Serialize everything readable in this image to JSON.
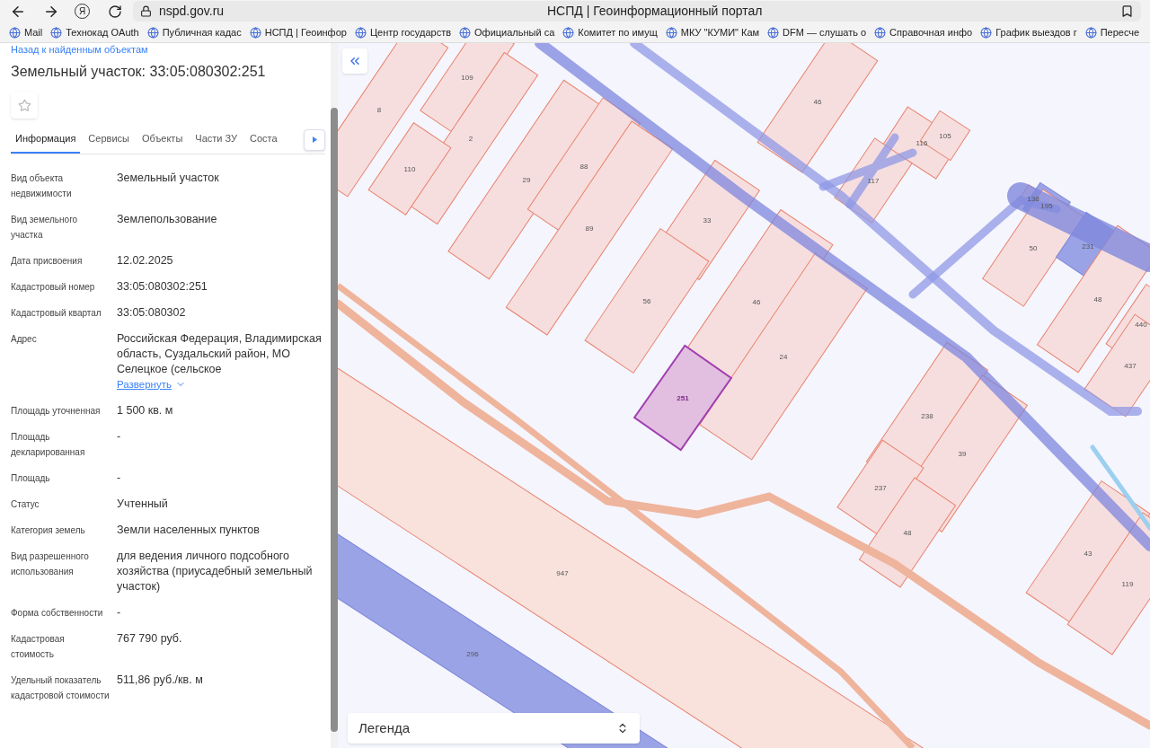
{
  "browser": {
    "home_glyph": "Я",
    "url": "nspd.gov.ru",
    "title": "НСПД | Геоинформационный портал",
    "bookmarks": [
      "Mail",
      "Технокад OAuth",
      "Публичная кадас",
      "НСПД | Геоинфор",
      "Центр государств",
      "Официальный са",
      "Комитет по имущ",
      "МКУ \"КУМИ\" Кам",
      "DFM — слушать о",
      "Справочная инфо",
      "График выездов г",
      "Пересче"
    ]
  },
  "panel": {
    "back_link": "Назад к найденным объектам",
    "title": "Земельный участок: 33:05:080302:251",
    "favorite": {
      "starred": false
    },
    "tabs": [
      {
        "label": "Информация",
        "selected": true
      },
      {
        "label": "Сервисы",
        "selected": false
      },
      {
        "label": "Объекты",
        "selected": false
      },
      {
        "label": "Части ЗУ",
        "selected": false
      },
      {
        "label": "Соста",
        "selected": false
      }
    ],
    "fields": [
      {
        "label": "Вид объекта недвижимости",
        "value": "Земельный участок"
      },
      {
        "label": "Вид земельного участка",
        "value": "Землепользование"
      },
      {
        "label": "Дата присвоения",
        "value": "12.02.2025"
      },
      {
        "label": "Кадастровый номер",
        "value": "33:05:080302:251"
      },
      {
        "label": "Кадастровый квартал",
        "value": "33:05:080302"
      },
      {
        "label": "Адрес",
        "value": "Российская Федерация, Владимирская область, Суздальский район, МО Селецкое (сельское",
        "expand_link": "Развернуть"
      },
      {
        "label": "Площадь уточненная",
        "value": "1 500 кв. м"
      },
      {
        "label": "Площадь декларированная",
        "value": "-"
      },
      {
        "label": "Площадь",
        "value": "-"
      },
      {
        "label": "Статус",
        "value": "Учтенный"
      },
      {
        "label": "Категория земель",
        "value": "Земли населенных пунктов"
      },
      {
        "label": "Вид разрешенного использования",
        "value": "для ведения личного подсобного хозяйства (приусадебный земельный участок)"
      },
      {
        "label": "Форма собственности",
        "value": "-"
      },
      {
        "label": "Кадастровая стоимость",
        "value": "767 790 руб."
      },
      {
        "label": "Удельный показатель кадастровой стоимости",
        "value": "511,86 руб./кв. м"
      }
    ]
  },
  "map": {
    "legend": {
      "label": "Легенда"
    },
    "parcels": [
      {
        "label": "8",
        "kind": "parcel",
        "selected": false
      },
      {
        "label": "109",
        "kind": "parcel",
        "selected": false
      },
      {
        "label": "2",
        "kind": "parcel",
        "selected": false
      },
      {
        "label": "110",
        "kind": "parcel",
        "selected": false
      },
      {
        "label": "29",
        "kind": "parcel",
        "selected": false
      },
      {
        "label": "88",
        "kind": "parcel",
        "selected": false
      },
      {
        "label": "89",
        "kind": "parcel",
        "selected": false
      },
      {
        "label": "33",
        "kind": "parcel",
        "selected": false
      },
      {
        "label": "56",
        "kind": "parcel",
        "selected": false
      },
      {
        "label": "46",
        "kind": "parcel",
        "selected": false
      },
      {
        "label": "24",
        "kind": "parcel",
        "selected": false
      },
      {
        "label": "251",
        "kind": "parcel",
        "selected": true
      },
      {
        "label": "46",
        "kind": "parcel",
        "selected": false
      },
      {
        "label": "116",
        "kind": "parcel",
        "selected": false
      },
      {
        "label": "105",
        "kind": "parcel",
        "selected": false
      },
      {
        "label": "117",
        "kind": "parcel",
        "selected": false
      },
      {
        "label": "138",
        "kind": "parcel",
        "selected": false
      },
      {
        "label": "195",
        "kind": "utility",
        "selected": false
      },
      {
        "label": "50",
        "kind": "parcel",
        "selected": false
      },
      {
        "label": "231",
        "kind": "utility",
        "selected": false
      },
      {
        "label": "48",
        "kind": "parcel",
        "selected": false
      },
      {
        "label": "440",
        "kind": "parcel",
        "selected": false
      },
      {
        "label": "437",
        "kind": "parcel",
        "selected": false
      },
      {
        "label": "238",
        "kind": "parcel",
        "selected": false
      },
      {
        "label": "39",
        "kind": "parcel",
        "selected": false
      },
      {
        "label": "237",
        "kind": "parcel",
        "selected": false
      },
      {
        "label": "48",
        "kind": "parcel",
        "selected": false
      },
      {
        "label": "43",
        "kind": "parcel",
        "selected": false
      },
      {
        "label": "119",
        "kind": "parcel",
        "selected": false
      },
      {
        "label": "947",
        "kind": "road",
        "selected": false
      },
      {
        "label": "296",
        "kind": "utility",
        "selected": false
      }
    ]
  }
}
